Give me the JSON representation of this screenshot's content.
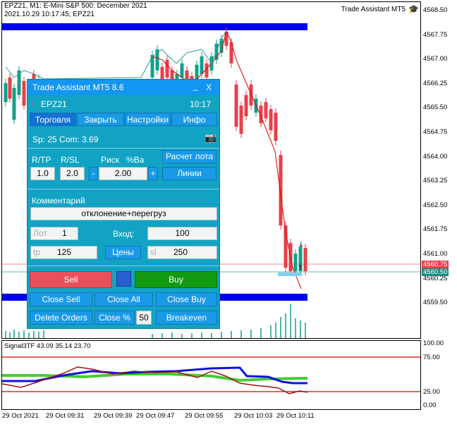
{
  "header": {
    "line1": "EPZ21, M1:  E-Mini S&P 500: December 2021",
    "line2": "2021.10.29 10:17:45; EPZ21",
    "badge": "Trade Assistant MT5"
  },
  "price_axis": [
    "4568.50",
    "4567.75",
    "4567.00",
    "4566.25",
    "4565.50",
    "4564.75",
    "4564.00",
    "4563.25",
    "4562.50",
    "4561.75",
    "4561.00",
    "4560.25",
    "4559.50"
  ],
  "price_tags": {
    "red": "4560.75",
    "teal": "4560.50"
  },
  "time_axis": [
    "29 Oct 2021",
    "29 Oct 09:31",
    "29 Oct 09:39",
    "29 Oct 09:47",
    "29 Oct 09:55",
    "29 Oct 10:03",
    "29 Oct 10:11"
  ],
  "indicator": {
    "label": "Signal3TF 43.09 35.14 23.70",
    "levels": [
      "100.00",
      "75.00",
      "25.00",
      "0.00"
    ]
  },
  "colors": {
    "bull": "#10a08a",
    "bear": "#e8404a",
    "zigzag": "#dd0000",
    "band": "#0000ee",
    "panel": "#12a3c4"
  },
  "panel": {
    "title": "Trade Assistant MT5 8.6",
    "minimize": "_",
    "close": "X",
    "symbol": "EPZ21",
    "time": "10:17",
    "tabs": [
      "Торговля",
      "Закрыть",
      "Настройки",
      "Инфо"
    ],
    "spread": "Sp: 25  Com: 3.69",
    "camera_icon": "camera-icon",
    "rtp_label": "R/TP",
    "rsl_label": "R/SL",
    "risk_label": "Риск",
    "pct_label": "%Ba",
    "calc_button": "Расчет лота",
    "rtp_value": "1.0",
    "rsl_value": "2.0",
    "minus": "-",
    "risk_value": "2.00",
    "plus": "+",
    "lines_button": "Линии",
    "comment_label": "Комментарий",
    "comment_value": "отклонение+перегруз",
    "lot_label": "Лот",
    "lot_value": "1",
    "entry_label": "Вход:",
    "entry_value": "100",
    "tp_label": "tp",
    "tp_value": "125",
    "prices_button": "Цены",
    "sl_label": "sl",
    "sl_value": "250",
    "sell": "Sell",
    "buy": "Buy",
    "close_sell": "Close Sell",
    "close_all": "Close All",
    "close_buy": "Close Buy",
    "delete_orders": "Delete Orders",
    "close_pct": "Close %",
    "close_pct_value": "50",
    "breakeven": "Breakeven"
  }
}
